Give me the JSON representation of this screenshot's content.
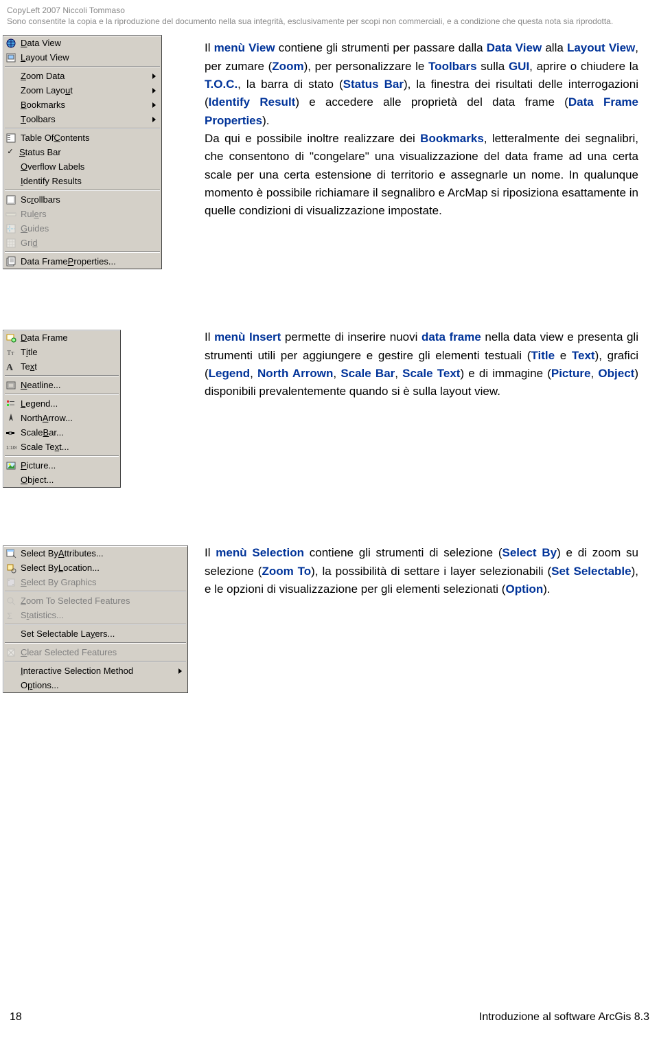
{
  "header": {
    "line1": "CopyLeft 2007 Niccoli Tommaso",
    "line2": "Sono consentite la copia e la riproduzione del documento nella sua integrità, esclusivamente per scopi non commerciali, e a condizione che questa nota sia riprodotta."
  },
  "view_menu": {
    "items": [
      {
        "pre": "",
        "mn": "D",
        "post": "ata View",
        "icon": "globe-icon"
      },
      {
        "pre": "",
        "mn": "L",
        "post": "ayout View",
        "icon": "layout-icon"
      },
      {
        "sep": true
      },
      {
        "pre": "",
        "mn": "Z",
        "post": "oom Data",
        "arrow": true
      },
      {
        "pre": "Zoom Layo",
        "mn": "u",
        "post": "t",
        "arrow": true
      },
      {
        "pre": "",
        "mn": "B",
        "post": "ookmarks",
        "arrow": true
      },
      {
        "pre": "",
        "mn": "T",
        "post": "oolbars",
        "arrow": true
      },
      {
        "sep": true
      },
      {
        "pre": "Table Of ",
        "mn": "C",
        "post": "ontents",
        "icon": "toc-icon"
      },
      {
        "pre": "",
        "mn": "S",
        "post": "tatus Bar",
        "check": true
      },
      {
        "pre": "",
        "mn": "O",
        "post": "verflow Labels"
      },
      {
        "pre": "",
        "mn": "I",
        "post": "dentify Results"
      },
      {
        "sep": true
      },
      {
        "pre": "Sc",
        "mn": "r",
        "post": "ollbars",
        "icon": "scroll-icon"
      },
      {
        "pre": "Rul",
        "mn": "e",
        "post": "rs",
        "icon": "ruler-icon",
        "disabled": true
      },
      {
        "pre": "",
        "mn": "G",
        "post": "uides",
        "icon": "guides-icon",
        "disabled": true
      },
      {
        "pre": "Gri",
        "mn": "d",
        "post": "",
        "icon": "grid-icon",
        "disabled": true
      },
      {
        "sep": true
      },
      {
        "pre": "Data Frame ",
        "mn": "P",
        "post": "roperties...",
        "icon": "props-icon"
      }
    ]
  },
  "insert_menu": {
    "items": [
      {
        "pre": "",
        "mn": "D",
        "post": "ata Frame",
        "icon": "dataframe-icon"
      },
      {
        "pre": "T",
        "mn": "i",
        "post": "tle",
        "icon": "title-icon"
      },
      {
        "pre": "Te",
        "mn": "x",
        "post": "t",
        "icon": "text-icon"
      },
      {
        "sep": true
      },
      {
        "pre": "",
        "mn": "N",
        "post": "eatline...",
        "icon": "neatline-icon"
      },
      {
        "sep": true
      },
      {
        "pre": "",
        "mn": "L",
        "post": "egend...",
        "icon": "legend-icon"
      },
      {
        "pre": "North ",
        "mn": "A",
        "post": "rrow...",
        "icon": "north-icon"
      },
      {
        "pre": "Scale ",
        "mn": "B",
        "post": "ar...",
        "icon": "scalebar-icon"
      },
      {
        "pre": "Scale Te",
        "mn": "x",
        "post": "t...",
        "icon": "scaletext-icon"
      },
      {
        "sep": true
      },
      {
        "pre": "",
        "mn": "P",
        "post": "icture...",
        "icon": "picture-icon"
      },
      {
        "pre": "",
        "mn": "O",
        "post": "bject...",
        "blank": true
      }
    ]
  },
  "selection_menu": {
    "items": [
      {
        "pre": "Select By ",
        "mn": "A",
        "post": "ttributes...",
        "icon": "selattr-icon"
      },
      {
        "pre": "Select By ",
        "mn": "L",
        "post": "ocation...",
        "icon": "selloc-icon"
      },
      {
        "pre": "",
        "mn": "S",
        "post": "elect By Graphics",
        "icon": "selgfx-icon",
        "disabled": true
      },
      {
        "sep": true
      },
      {
        "pre": "",
        "mn": "Z",
        "post": "oom To Selected Features",
        "icon": "zoomsel-icon",
        "disabled": true
      },
      {
        "pre": "S",
        "mn": "t",
        "post": "atistics...",
        "icon": "stats-icon",
        "disabled": true
      },
      {
        "sep": true
      },
      {
        "pre": "Set Selectable La",
        "mn": "y",
        "post": "ers...",
        "blank": true
      },
      {
        "sep": true
      },
      {
        "pre": "",
        "mn": "C",
        "post": "lear Selected Features",
        "icon": "clear-icon",
        "disabled": true
      },
      {
        "sep": true
      },
      {
        "pre": "",
        "mn": "I",
        "post": "nteractive Selection Method",
        "arrow": true,
        "blank": true
      },
      {
        "pre": "O",
        "mn": "p",
        "post": "tions...",
        "blank": true
      }
    ]
  },
  "para1": {
    "t1": "Il ",
    "b1": "menù View",
    "t2": " contiene gli strumenti per passare dalla ",
    "b2": "Data View",
    "t3": " alla ",
    "b3": "Layout View",
    "t4": ", per zumare (",
    "b4": "Zoom",
    "t5": "), per personalizzare le ",
    "b5": "Toolbars",
    "t6": " sulla ",
    "b6": "GUI",
    "t7": ", aprire o chiudere la ",
    "b7": "T.O.C.",
    "t8": ", la barra di stato (",
    "b8": "Status Bar",
    "t9": "), la finestra dei risultati delle interrogazioni (",
    "b9": "Identify Result",
    "t10": ") e accedere alle proprietà del data frame (",
    "b10": "Data Frame Properties",
    "t11": ")."
  },
  "para1b": {
    "t1": "Da qui e possibile inoltre realizzare dei ",
    "b1": "Bookmarks",
    "t2": ", letteralmente dei segnalibri, che consentono di \"congelare\" una visualizzazione del data frame ad una certa scale per una certa estensione di territorio e assegnarle un nome. In qualunque momento è possibile richiamare il segnalibro e ArcMap si riposiziona esattamente in quelle condizioni di visualizzazione impostate."
  },
  "para2": {
    "t1": "Il ",
    "b1": "menù Insert",
    "t2": " permette di inserire nuovi ",
    "b2": "data frame",
    "t3": " nella data view e presenta gli strumenti utili per aggiungere e gestire gli elementi testuali (",
    "b3": "Title",
    "t4": " e ",
    "b4": "Text",
    "t5": "), grafici (",
    "b5": "Legend",
    "t6": ", ",
    "b6": "North Arrown",
    "t7": ", ",
    "b7": "Scale Bar",
    "t8": ", ",
    "b8": "Scale Text",
    "t9": ") e di immagine (",
    "b9": "Picture",
    "t10": ", ",
    "b10": "Object",
    "t11": ") disponibili prevalentemente quando si è sulla layout view."
  },
  "para3": {
    "t1": "Il ",
    "b1": "menù Selection",
    "t2": " contiene gli strumenti di selezione (",
    "b2": "Select By",
    "t3": ") e di zoom su selezione (",
    "b3": "Zoom To",
    "t4": "), la possibilità di settare i layer selezionabili (",
    "b4": "Set Selectable",
    "t5": "), e le opzioni di visualizzazione per gli elementi selezionati (",
    "b5": "Option",
    "t6": ")."
  },
  "footer": {
    "page": "18",
    "title": "Introduzione al software ArcGis 8.3"
  }
}
